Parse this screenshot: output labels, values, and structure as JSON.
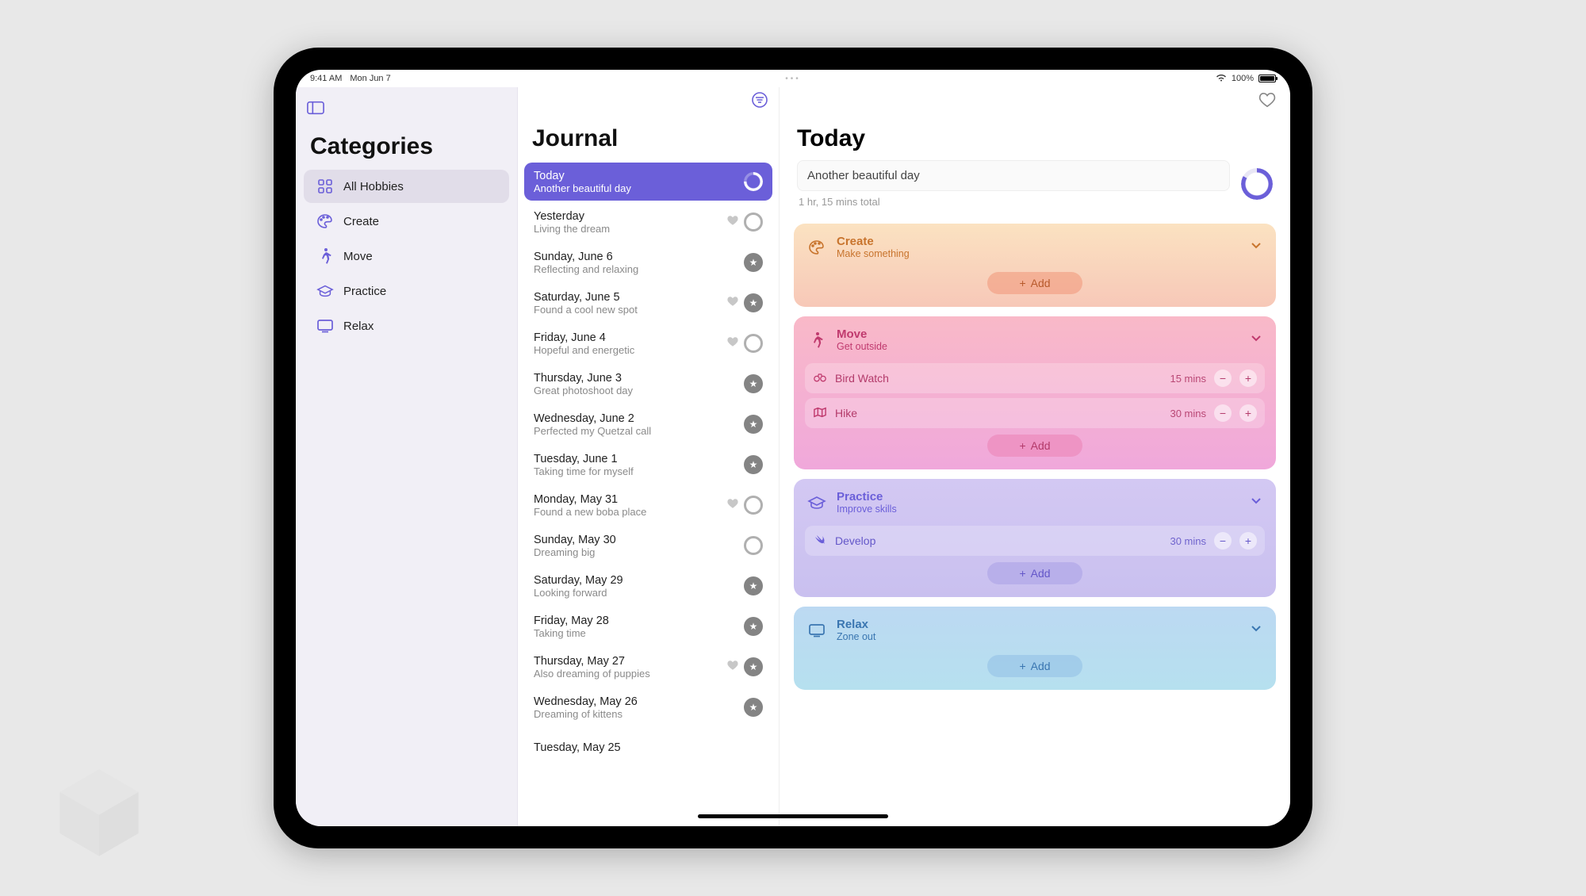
{
  "status": {
    "time": "9:41 AM",
    "date": "Mon Jun 7",
    "battery_pct": "100%"
  },
  "sidebar": {
    "title": "Categories",
    "items": [
      {
        "label": "All Hobbies",
        "icon": "grid",
        "selected": true
      },
      {
        "label": "Create",
        "icon": "palette",
        "selected": false
      },
      {
        "label": "Move",
        "icon": "walker",
        "selected": false
      },
      {
        "label": "Practice",
        "icon": "gradcap",
        "selected": false
      },
      {
        "label": "Relax",
        "icon": "tv",
        "selected": false
      }
    ]
  },
  "journal": {
    "title": "Journal",
    "entries": [
      {
        "title": "Today",
        "sub": "Another beautiful day",
        "selected": true,
        "heart": false,
        "badge": "ring-white-partial"
      },
      {
        "title": "Yesterday",
        "sub": "Living the dream",
        "heart": true,
        "badge": "ring-outline"
      },
      {
        "title": "Sunday, June 6",
        "sub": "Reflecting and relaxing",
        "heart": false,
        "badge": "star"
      },
      {
        "title": "Saturday, June 5",
        "sub": "Found a cool new spot",
        "heart": true,
        "badge": "star"
      },
      {
        "title": "Friday, June 4",
        "sub": "Hopeful and energetic",
        "heart": true,
        "badge": "ring-outline"
      },
      {
        "title": "Thursday, June 3",
        "sub": "Great photoshoot day",
        "heart": false,
        "badge": "star"
      },
      {
        "title": "Wednesday, June 2",
        "sub": "Perfected my Quetzal call",
        "heart": false,
        "badge": "star"
      },
      {
        "title": "Tuesday, June 1",
        "sub": "Taking time for myself",
        "heart": false,
        "badge": "star"
      },
      {
        "title": "Monday, May 31",
        "sub": "Found a new boba place",
        "heart": true,
        "badge": "ring-outline"
      },
      {
        "title": "Sunday, May 30",
        "sub": "Dreaming big",
        "heart": false,
        "badge": "ring-outline"
      },
      {
        "title": "Saturday, May 29",
        "sub": "Looking forward",
        "heart": false,
        "badge": "star"
      },
      {
        "title": "Friday, May 28",
        "sub": "Taking time",
        "heart": false,
        "badge": "star"
      },
      {
        "title": "Thursday, May 27",
        "sub": "Also dreaming of puppies",
        "heart": true,
        "badge": "star"
      },
      {
        "title": "Wednesday, May 26",
        "sub": "Dreaming of kittens",
        "heart": false,
        "badge": "star"
      },
      {
        "title": "Tuesday, May 25",
        "sub": "",
        "heart": false,
        "badge": ""
      }
    ]
  },
  "detail": {
    "title": "Today",
    "summary": "Another beautiful day",
    "duration": "1 hr, 15 mins total",
    "add_label": "Add",
    "cards": [
      {
        "key": "create",
        "title": "Create",
        "sub": "Make something",
        "activities": []
      },
      {
        "key": "move",
        "title": "Move",
        "sub": "Get outside",
        "activities": [
          {
            "name": "Bird Watch",
            "dur": "15 mins",
            "icon": "binoculars"
          },
          {
            "name": "Hike",
            "dur": "30 mins",
            "icon": "map"
          }
        ]
      },
      {
        "key": "practice",
        "title": "Practice",
        "sub": "Improve skills",
        "activities": [
          {
            "name": "Develop",
            "dur": "30 mins",
            "icon": "swift"
          }
        ]
      },
      {
        "key": "relax",
        "title": "Relax",
        "sub": "Zone out",
        "activities": []
      }
    ]
  }
}
